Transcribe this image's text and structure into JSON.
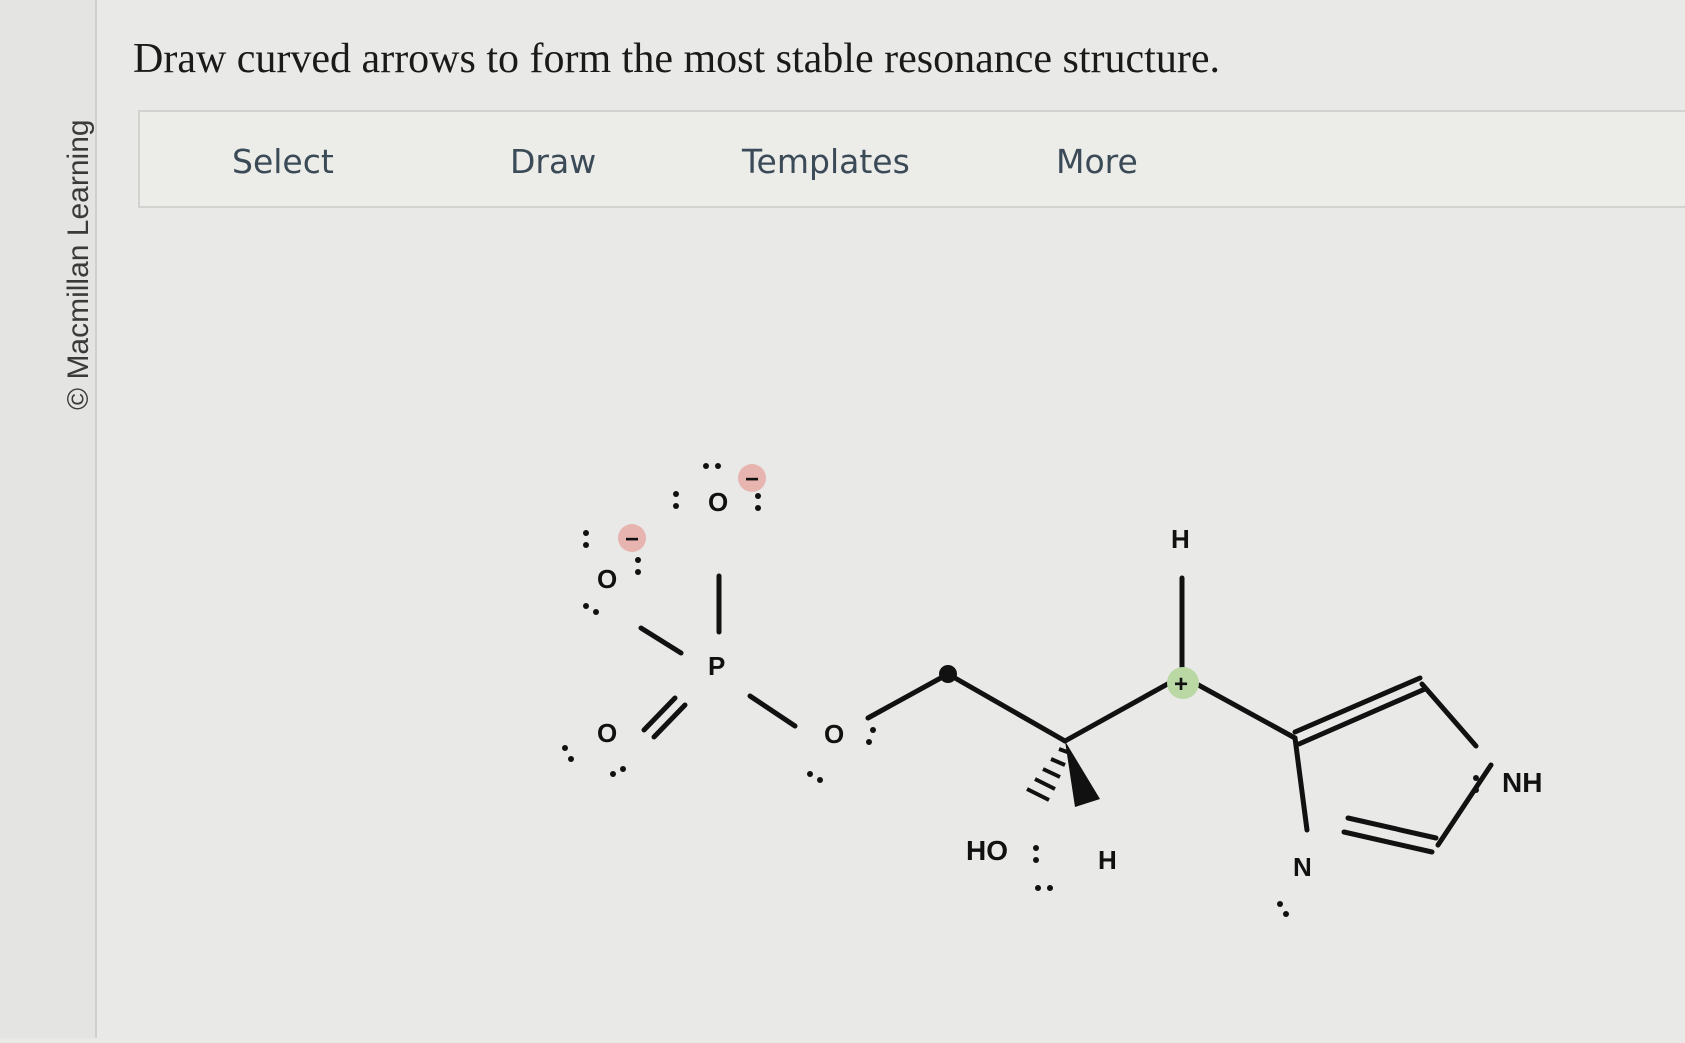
{
  "sidebar": {
    "copyright": "© Macmillan Learning"
  },
  "question": {
    "text": "Draw curved arrows to form the most stable resonance structure."
  },
  "toolbar": {
    "select_label": "Select",
    "draw_label": "Draw",
    "templates_label": "Templates",
    "more_label": "More"
  },
  "molecule": {
    "atoms": {
      "o_top": "O",
      "o_left_upper": "O",
      "o_left_lower": "O",
      "p": "P",
      "o_bridge": "O",
      "h_top": "H",
      "ho": "HO",
      "h_wedge": "H",
      "n": "N",
      "nh": "NH"
    },
    "charges": {
      "o_top": "−",
      "o_left_upper": "−",
      "c_cation": "+"
    },
    "colors": {
      "negative_charge_bg": "#e8b4b0",
      "positive_charge_bg": "#b9d8a4",
      "bond": "#111111"
    }
  }
}
